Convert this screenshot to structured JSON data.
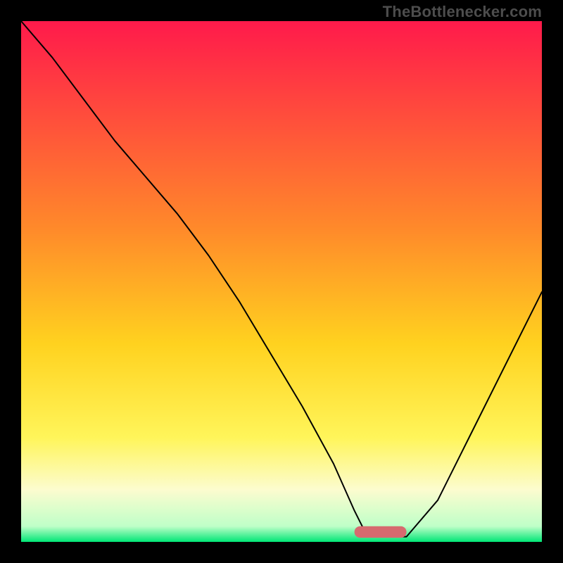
{
  "watermark": "TheBottlenecker.com",
  "chart_data": {
    "type": "line",
    "title": "",
    "xlabel": "",
    "ylabel": "",
    "xlim": [
      0,
      100
    ],
    "ylim": [
      0,
      100
    ],
    "grid": false,
    "background": {
      "type": "vertical-gradient",
      "stops": [
        {
          "offset": 0,
          "color": "#ff1a4b"
        },
        {
          "offset": 0.4,
          "color": "#ff8a2a"
        },
        {
          "offset": 0.62,
          "color": "#ffd21f"
        },
        {
          "offset": 0.8,
          "color": "#fff55a"
        },
        {
          "offset": 0.9,
          "color": "#fcfccf"
        },
        {
          "offset": 0.97,
          "color": "#bfffc8"
        },
        {
          "offset": 1.0,
          "color": "#00e676"
        }
      ]
    },
    "series": [
      {
        "name": "bottleneck-curve",
        "stroke": "#000000",
        "stroke_width": 2,
        "x": [
          0,
          6,
          12,
          18,
          24,
          30,
          36,
          42,
          48,
          54,
          60,
          64,
          66,
          70,
          74,
          80,
          86,
          92,
          100
        ],
        "y": [
          100,
          93,
          85,
          77,
          70,
          63,
          55,
          46,
          36,
          26,
          15,
          6,
          2,
          1,
          1,
          8,
          20,
          32,
          48
        ]
      }
    ],
    "marker": {
      "name": "optimal-range",
      "shape": "rounded-bar",
      "color": "#d66a6f",
      "x_start": 64,
      "x_end": 74,
      "y": 0.8,
      "height": 2.2
    }
  }
}
